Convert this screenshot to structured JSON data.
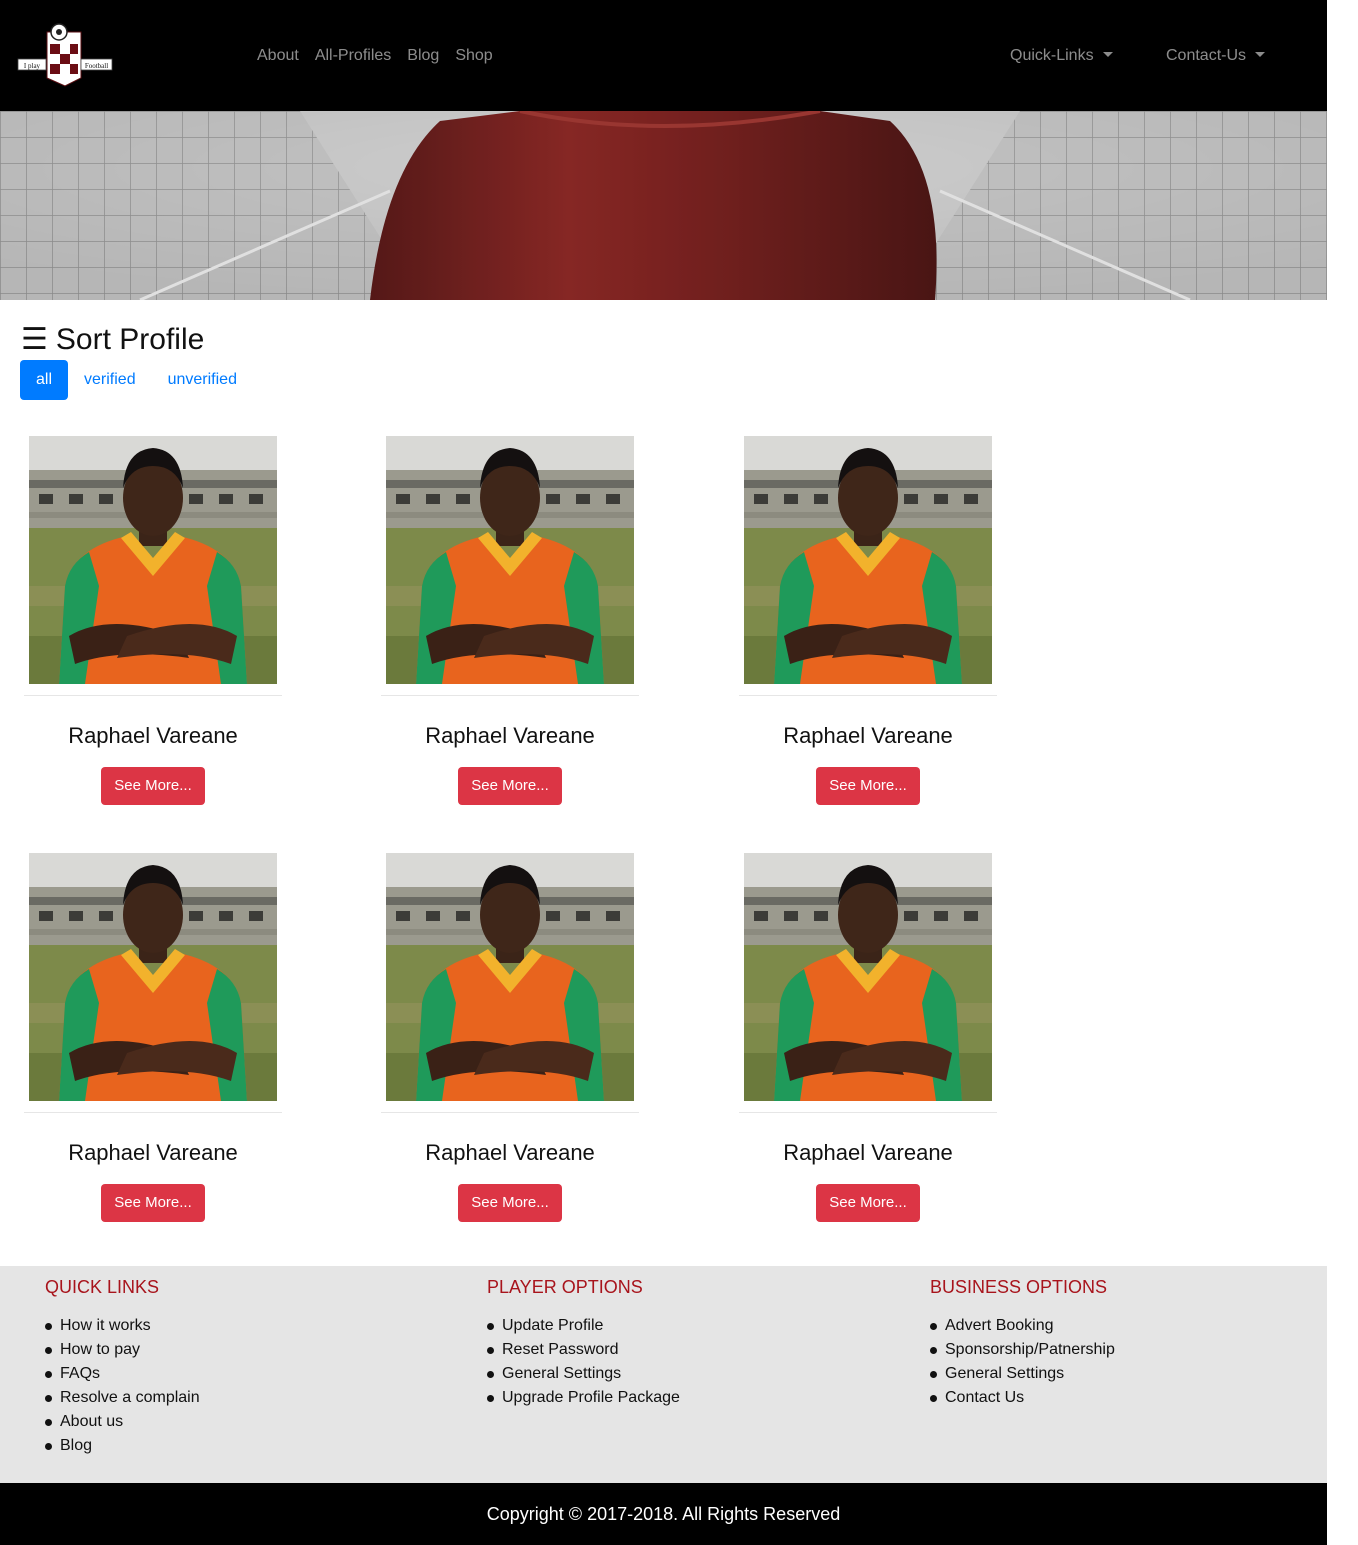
{
  "navbar": {
    "logo_left_text": "I play",
    "logo_right_text": "Football",
    "links": [
      "About",
      "All-Profiles",
      "Blog",
      "Shop"
    ],
    "quick_links_label": "Quick-Links",
    "contact_label": "Contact-Us"
  },
  "sort": {
    "title": "Sort Profile",
    "icon_glyph": "☰",
    "options": [
      "all",
      "verified",
      "unverified"
    ],
    "active": "all"
  },
  "profiles": [
    {
      "name": "Raphael Vareane",
      "button": "See More..."
    },
    {
      "name": "Raphael Vareane",
      "button": "See More..."
    },
    {
      "name": "Raphael Vareane",
      "button": "See More..."
    },
    {
      "name": "Raphael Vareane",
      "button": "See More..."
    },
    {
      "name": "Raphael Vareane",
      "button": "See More..."
    },
    {
      "name": "Raphael Vareane",
      "button": "See More..."
    }
  ],
  "footer": {
    "quick_links": {
      "title": "QUICK LINKS",
      "items": [
        "How it works",
        "How to pay",
        "FAQs",
        "Resolve a complain",
        "About us",
        "Blog"
      ]
    },
    "player_options": {
      "title": "PLAYER OPTIONS",
      "items": [
        "Update Profile",
        "Reset Password",
        "General Settings",
        "Upgrade Profile Package"
      ]
    },
    "business_options": {
      "title": "BUSINESS OPTIONS",
      "items": [
        "Advert Booking",
        "Sponsorship/Patnership",
        "General Settings",
        "Contact Us"
      ]
    },
    "copyright": "Copyright © 2017-2018. All Rights Reserved"
  },
  "colors": {
    "navbar_bg": "#000000",
    "pill_active": "#007bff",
    "button_red": "#dc3545",
    "footer_heading": "#a8141c",
    "footer_bg": "#e5e5e5"
  }
}
